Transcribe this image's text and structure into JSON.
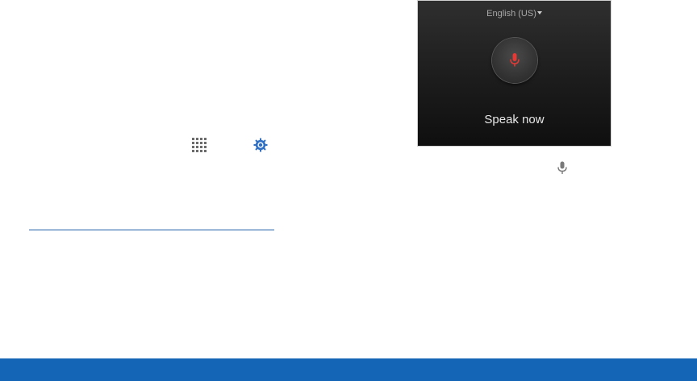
{
  "voice_panel": {
    "language": "English (US)",
    "prompt": "Speak now"
  },
  "icons": {
    "apps": "apps-grid-icon",
    "settings": "settings-gear-icon",
    "mic_large": "microphone-icon",
    "mic_small": "microphone-icon"
  },
  "colors": {
    "accent": "#1565b6",
    "divider": "#1f5fa8",
    "mic_red": "#e53935",
    "settings_blue": "#2f6fc4"
  }
}
